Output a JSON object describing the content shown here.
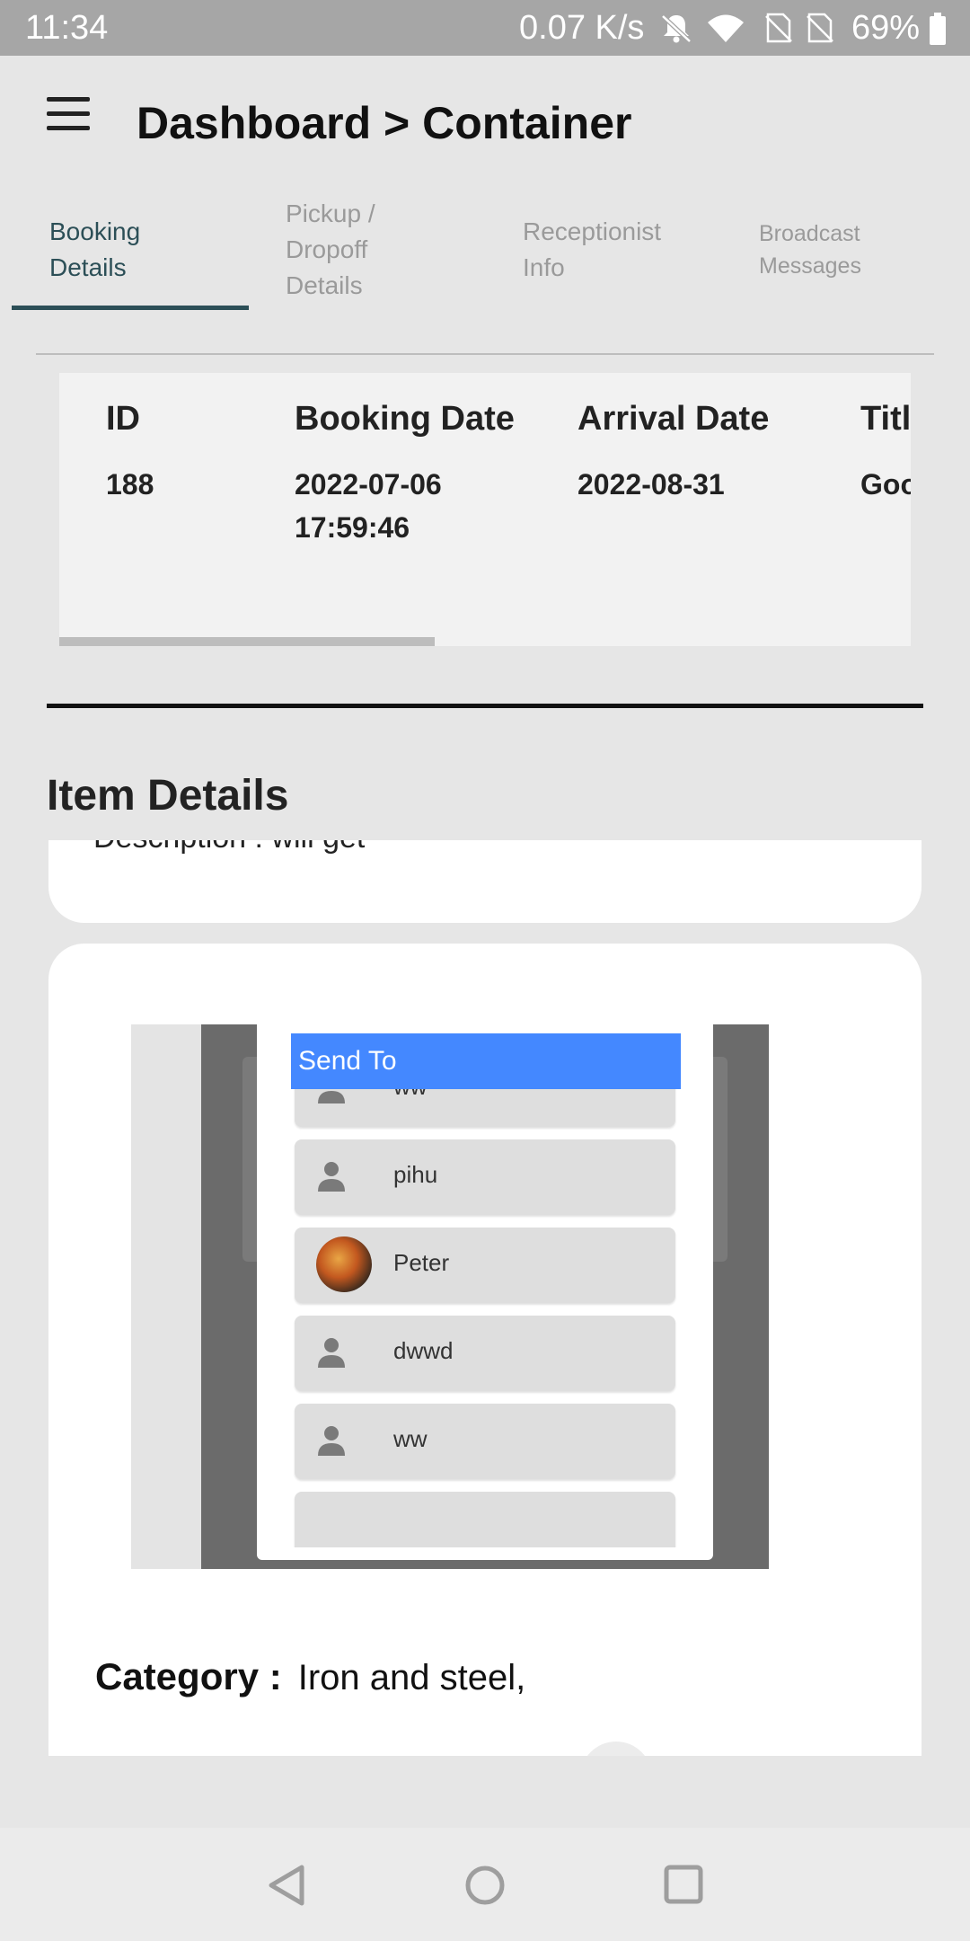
{
  "status_bar": {
    "time": "11:34",
    "network_speed": "0.07 K/s",
    "battery": "69%",
    "icons": [
      "bell-off-icon",
      "wifi-icon",
      "no-sim-icon",
      "no-sim-icon",
      "battery-icon"
    ]
  },
  "header": {
    "menu_icon": "hamburger-icon",
    "title": "Dashboard > Container"
  },
  "tabs": [
    {
      "label_lines": [
        "Booking",
        "Details"
      ],
      "active": true
    },
    {
      "label_lines": [
        "Pickup /",
        "Dropoff",
        "Details"
      ],
      "active": false
    },
    {
      "label_lines": [
        "Receptionist",
        "Info"
      ],
      "active": false
    },
    {
      "label_lines": [
        "Broadcast",
        "Messages"
      ],
      "active": false
    }
  ],
  "booking_table": {
    "headers": [
      "ID",
      "Booking Date",
      "Arrival Date",
      "Titl"
    ],
    "row": {
      "id": "188",
      "booking_date_line1": "2022-07-06",
      "booking_date_line2": "17:59:46",
      "arrival_date": "2022-08-31",
      "title": "Goo"
    }
  },
  "item_details": {
    "heading": "Item Details",
    "description_partial": "Description :  will get",
    "screenshot": {
      "dialog_title": "Send To",
      "contacts": [
        {
          "name": "ww",
          "icon": "person-icon"
        },
        {
          "name": "pihu",
          "icon": "person-icon"
        },
        {
          "name": "Peter",
          "icon": "avatar-photo"
        },
        {
          "name": "dwwd",
          "icon": "person-icon"
        },
        {
          "name": "ww",
          "icon": "person-icon"
        }
      ]
    },
    "category_label": "Category :",
    "category_value": "Iron and steel,"
  },
  "nav_bar": {
    "icons": [
      "back-icon",
      "home-icon",
      "recents-icon"
    ]
  },
  "colors": {
    "accent": "#2c4f57",
    "dialog_header": "#4488ff",
    "status_bar": "#a6a6a6"
  }
}
